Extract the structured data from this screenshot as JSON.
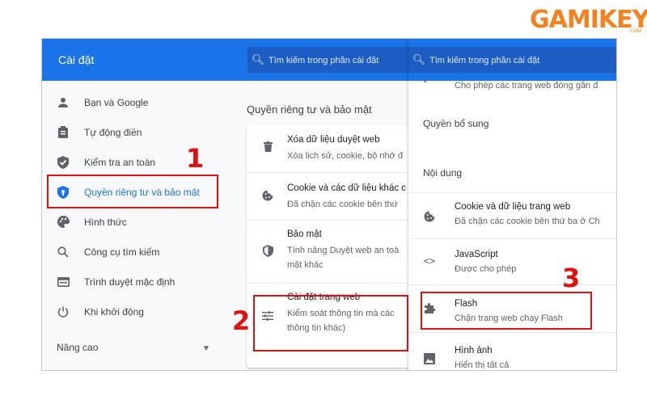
{
  "logo": {
    "text": "GAMIKEY",
    "suffix": ".COM"
  },
  "header": {
    "title": "Cài đặt",
    "search_placeholder": "Tìm kiếm trong phần cài đặt",
    "search_icon": "search-icon"
  },
  "sidebar": {
    "items": [
      {
        "label": "Bạn và Google",
        "icon": "person-icon"
      },
      {
        "label": "Tự động điền",
        "icon": "clipboard-icon"
      },
      {
        "label": "Kiểm tra an toàn",
        "icon": "shield-check-icon"
      },
      {
        "label": "Quyền riêng tư và bảo mật",
        "icon": "shield-icon",
        "active": true
      },
      {
        "label": "Hình thức",
        "icon": "palette-icon"
      },
      {
        "label": "Công cụ tìm kiếm",
        "icon": "search-icon"
      },
      {
        "label": "Trình duyệt mặc định",
        "icon": "browser-icon"
      },
      {
        "label": "Khi khởi động",
        "icon": "power-icon"
      }
    ],
    "advanced": "Nâng cao"
  },
  "privacy": {
    "title": "Quyền riêng tư và bảo mật",
    "rows": [
      {
        "title": "Xóa dữ liệu duyệt web",
        "desc": [
          "Xóa lịch sử, cookie, bộ nhớ đ"
        ],
        "icon": "trash-icon"
      },
      {
        "title": "Cookie và các dữ liệu khác c",
        "desc": [
          "Đã chặn các cookie bên thứ"
        ],
        "icon": "cookie-icon"
      },
      {
        "title": "Bảo mật",
        "desc": [
          "Tính năng Duyệt web an toà",
          "mật khác"
        ],
        "icon": "shield-icon"
      },
      {
        "title": "Cài đặt trang web",
        "desc": [
          "Kiểm soát thông tin mà các",
          "thông tin khác)"
        ],
        "icon": "sliders-icon"
      }
    ]
  },
  "site_settings": {
    "top_fragment": "Cho phép các trang web đóng gần đ",
    "section_additional": "Quyền bổ sung",
    "section_content": "Nội dung",
    "rows": [
      {
        "title": "Cookie và dữ liệu trang web",
        "desc": "Đã chặn các cookie bên thứ ba ở Ch",
        "icon": "cookie-icon"
      },
      {
        "title": "JavaScript",
        "desc": "Được cho phép",
        "icon": "code-icon"
      },
      {
        "title": "Flash",
        "desc": "Chặn trang web chạy Flash",
        "icon": "puzzle-icon"
      },
      {
        "title": "Hình ảnh",
        "desc": "Hiển thị tất cả",
        "icon": "image-icon"
      }
    ]
  },
  "annotations": {
    "step1": "1",
    "step2": "2",
    "step3": "3",
    "color": "#e01010"
  },
  "colors": {
    "accent": "#1a73e8",
    "header": "#1a73e8",
    "search": "#1b5dc2",
    "logo": "#f58220"
  }
}
